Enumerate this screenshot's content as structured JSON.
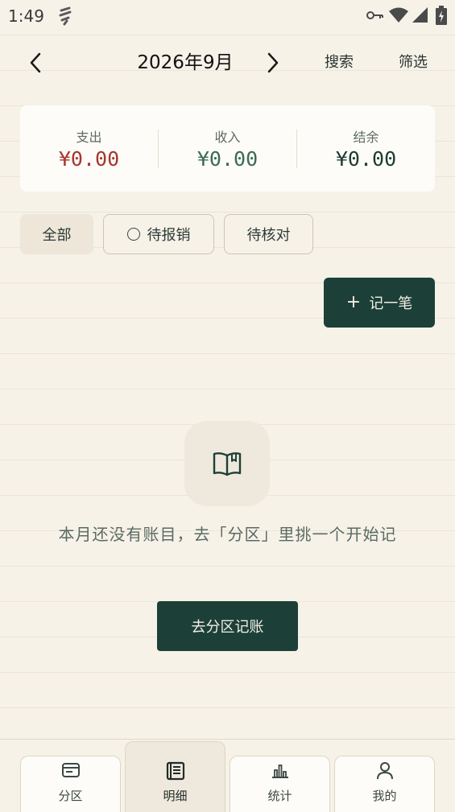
{
  "status_bar": {
    "time": "1:49"
  },
  "header": {
    "month": "2026年9月",
    "search_label": "搜索",
    "filter_label": "筛选"
  },
  "summary": {
    "expense_label": "支出",
    "expense_value": "¥0.00",
    "income_label": "收入",
    "income_value": "¥0.00",
    "balance_label": "结余",
    "balance_value": "¥0.00",
    "colors": {
      "expense": "#a8352e",
      "income": "#3b6b55",
      "balance": "#1f3b34"
    }
  },
  "filters": {
    "all": "全部",
    "pending_reimburse": "待报销",
    "pending_check": "待核对"
  },
  "add_button": {
    "icon": "plus-icon",
    "label": "记一笔"
  },
  "empty_state": {
    "icon": "book-icon",
    "message": "本月还没有账目，去「分区」里挑一个开始记",
    "cta_label": "去分区记账"
  },
  "bottom_nav": {
    "tabs": [
      {
        "label": "分区",
        "icon": "wallet-icon"
      },
      {
        "label": "明细",
        "icon": "list-doc-icon",
        "active": true
      },
      {
        "label": "统计",
        "icon": "bar-chart-icon"
      },
      {
        "label": "我的",
        "icon": "user-icon"
      }
    ]
  },
  "colors": {
    "accent": "#1c4038",
    "background": "#f6f2e8"
  }
}
